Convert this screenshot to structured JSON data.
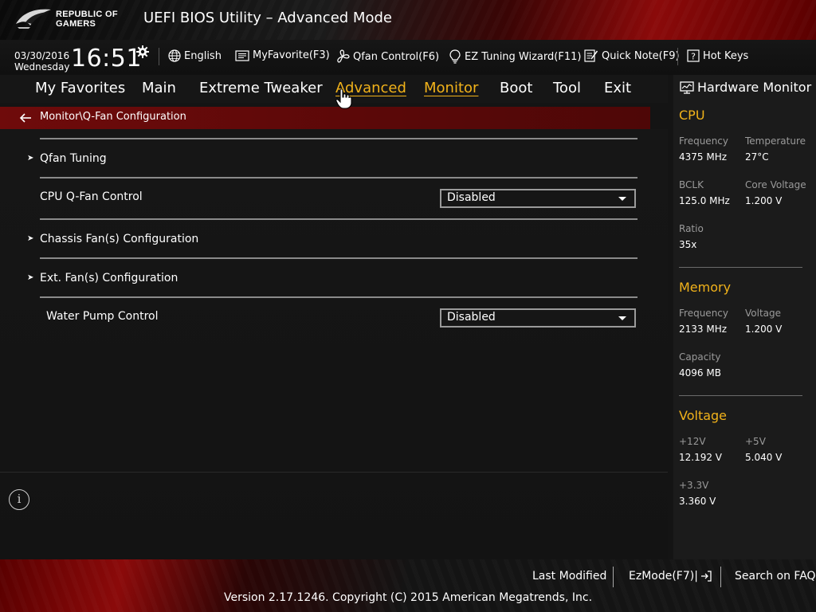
{
  "header": {
    "logo_line1": "REPUBLIC OF",
    "logo_line2": "GAMERS",
    "title": "UEFI BIOS Utility – Advanced Mode"
  },
  "infobar": {
    "date": "03/30/2016",
    "weekday": "Wednesday",
    "time": "16:51",
    "language": "English",
    "myfavorite": "MyFavorite(F3)",
    "qfan": "Qfan Control(F6)",
    "ez_tuning": "EZ Tuning Wizard(F11)",
    "quick_note": "Quick Note(F9)",
    "hot_keys": "Hot Keys"
  },
  "nav": {
    "items": [
      "My Favorites",
      "Main",
      "Extreme Tweaker",
      "Advanced",
      "Monitor",
      "Boot",
      "Tool",
      "Exit"
    ],
    "active": "Monitor",
    "hovered": "Advanced"
  },
  "breadcrumb": "Monitor\\Q-Fan Configuration",
  "settings": {
    "qfan_tuning": "Qfan Tuning",
    "cpu_qfan_label": "CPU Q-Fan Control",
    "cpu_qfan_value": "Disabled",
    "chassis_fans": "Chassis Fan(s) Configuration",
    "ext_fans": "Ext. Fan(s) Configuration",
    "water_pump_label": "Water Pump Control",
    "water_pump_value": "Disabled"
  },
  "hw_monitor": {
    "title": "Hardware Monitor",
    "cpu": {
      "heading": "CPU",
      "frequency_label": "Frequency",
      "frequency": "4375 MHz",
      "temperature_label": "Temperature",
      "temperature": "27°C",
      "bclk_label": "BCLK",
      "bclk": "125.0 MHz",
      "core_voltage_label": "Core Voltage",
      "core_voltage": "1.200 V",
      "ratio_label": "Ratio",
      "ratio": "35x"
    },
    "memory": {
      "heading": "Memory",
      "frequency_label": "Frequency",
      "frequency": "2133 MHz",
      "voltage_label": "Voltage",
      "voltage": "1.200 V",
      "capacity_label": "Capacity",
      "capacity": "4096 MB"
    },
    "voltage": {
      "heading": "Voltage",
      "v12_label": "+12V",
      "v12": "12.192 V",
      "v5_label": "+5V",
      "v5": "5.040 V",
      "v33_label": "+3.3V",
      "v33": "3.360 V"
    }
  },
  "footer": {
    "last_modified": "Last Modified",
    "ezmode": "EzMode(F7)|",
    "search_faq": "Search on FAQ",
    "copyright": "Version 2.17.1246. Copyright (C) 2015 American Megatrends, Inc."
  },
  "colors": {
    "accent": "#f1b21a",
    "rog_red": "#8b0a0a",
    "breadcrumb_bg": "#6f0b0b"
  }
}
